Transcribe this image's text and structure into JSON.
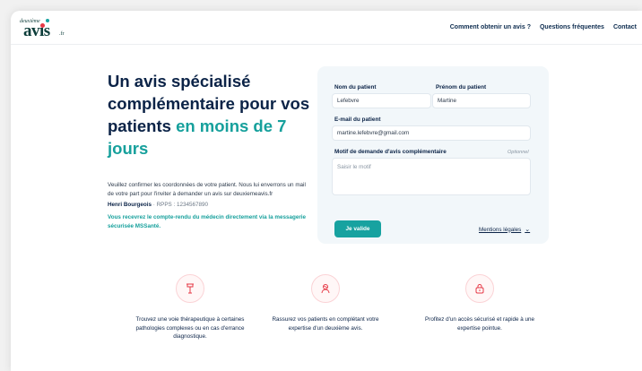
{
  "logo": {
    "small": "deuxième",
    "big": "avis",
    "tld": ".fr",
    "colors": {
      "red": "#e63946",
      "teal": "#17a2a0"
    }
  },
  "nav": {
    "items": [
      "Comment obtenir un avis ?",
      "Questions fréquentes",
      "Contact"
    ]
  },
  "hero": {
    "headline_part1": "Un avis spécialisé complémentaire pour vos patients",
    "headline_accent": " en moins de 7 jours",
    "description": "Veuillez confirmer les coordonnées de votre patient. Nous lui enverrons un mail de votre part pour l'inviter à demander un avis sur deuxiemeavis.fr",
    "doctor_name": "Henri Bourgeois",
    "doctor_rpps": " · RPPS : 1234567890",
    "notice": "Vous recevrez le compte-rendu du médecin directement via la messagerie sécurisée MSSanté."
  },
  "form": {
    "nom_label": "Nom du patient",
    "nom_value": "Lefebvre",
    "prenom_label": "Prénom du patient",
    "prenom_value": "Martine",
    "email_label": "E-mail du patient",
    "email_value": "martine.lefebvre@gmail.com",
    "motif_label": "Motif de demande d'avis complémentaire",
    "motif_optional": "Optionnel",
    "motif_placeholder": "Saisir le motif",
    "submit_label": "Je valide",
    "mentions_label": "Mentions légales"
  },
  "features": [
    {
      "icon": "therapy-icon",
      "text": "Trouvez une voie thérapeutique à certaines pathologies complexes ou en cas d'errance diagnostique."
    },
    {
      "icon": "reassure-icon",
      "text": "Rassurez vos patients en complétant votre expertise d'un deuxième avis."
    },
    {
      "icon": "lock-icon",
      "text": "Profitez d'un accès sécurisé et rapide à une expertise pointue."
    }
  ],
  "colors": {
    "navy": "#0b2347",
    "teal": "#17a2a0",
    "card_bg": "#f2f7fa",
    "icon_red": "#e63946"
  }
}
